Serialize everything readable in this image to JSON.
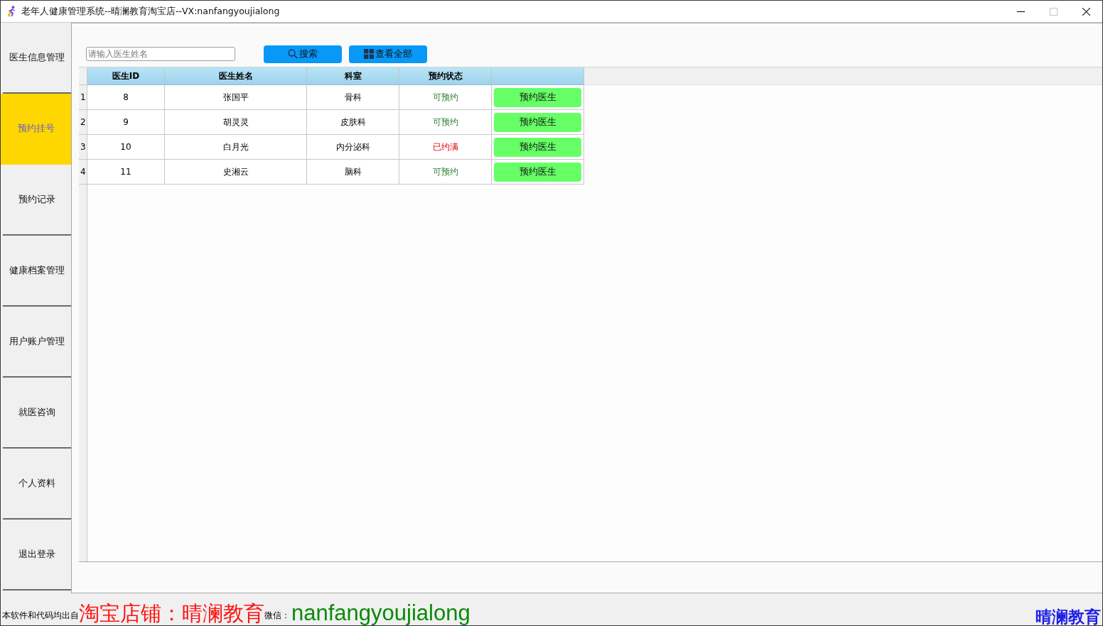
{
  "window": {
    "title": "老年人健康管理系统--晴澜教育淘宝店--VX:nanfangyoujialong"
  },
  "sidebar": {
    "items": [
      {
        "label": "医生信息管理",
        "selected": false
      },
      {
        "label": "预约挂号",
        "selected": true
      },
      {
        "label": "预约记录",
        "selected": false
      },
      {
        "label": "健康档案管理",
        "selected": false
      },
      {
        "label": "用户账户管理",
        "selected": false
      },
      {
        "label": "就医咨询",
        "selected": false
      },
      {
        "label": "个人资料",
        "selected": false
      },
      {
        "label": "退出登录",
        "selected": false
      }
    ]
  },
  "search": {
    "placeholder": "请输入医生姓名"
  },
  "toolbar_buttons": [
    {
      "label": "搜索",
      "kind": "search"
    },
    {
      "label": "查看全部",
      "kind": "grid"
    }
  ],
  "table": {
    "columns": [
      "医生ID",
      "医生姓名",
      "科室",
      "预约状态"
    ],
    "rows": [
      {
        "row_number": "1",
        "id": "8",
        "name": "张国平",
        "department": "骨科",
        "status": "可预约",
        "available": true,
        "action": "预约医生"
      },
      {
        "row_number": "2",
        "id": "9",
        "name": "胡灵灵",
        "department": "皮肤科",
        "status": "可预约",
        "available": true,
        "action": "预约医生"
      },
      {
        "row_number": "3",
        "id": "10",
        "name": "白月光",
        "department": "内分泌科",
        "status": "已约满",
        "available": false,
        "action": "预约医生"
      },
      {
        "row_number": "4",
        "id": "11",
        "name": "史湘云",
        "department": "脑科",
        "status": "可预约",
        "available": true,
        "action": "预约医生"
      }
    ]
  },
  "footer": {
    "prefix": "本软件和代码均出自",
    "shop": "淘宝店铺：晴澜教育",
    "wechat_label": "微信：",
    "wechat": "nanfangyoujialong",
    "brand": "晴澜教育"
  }
}
